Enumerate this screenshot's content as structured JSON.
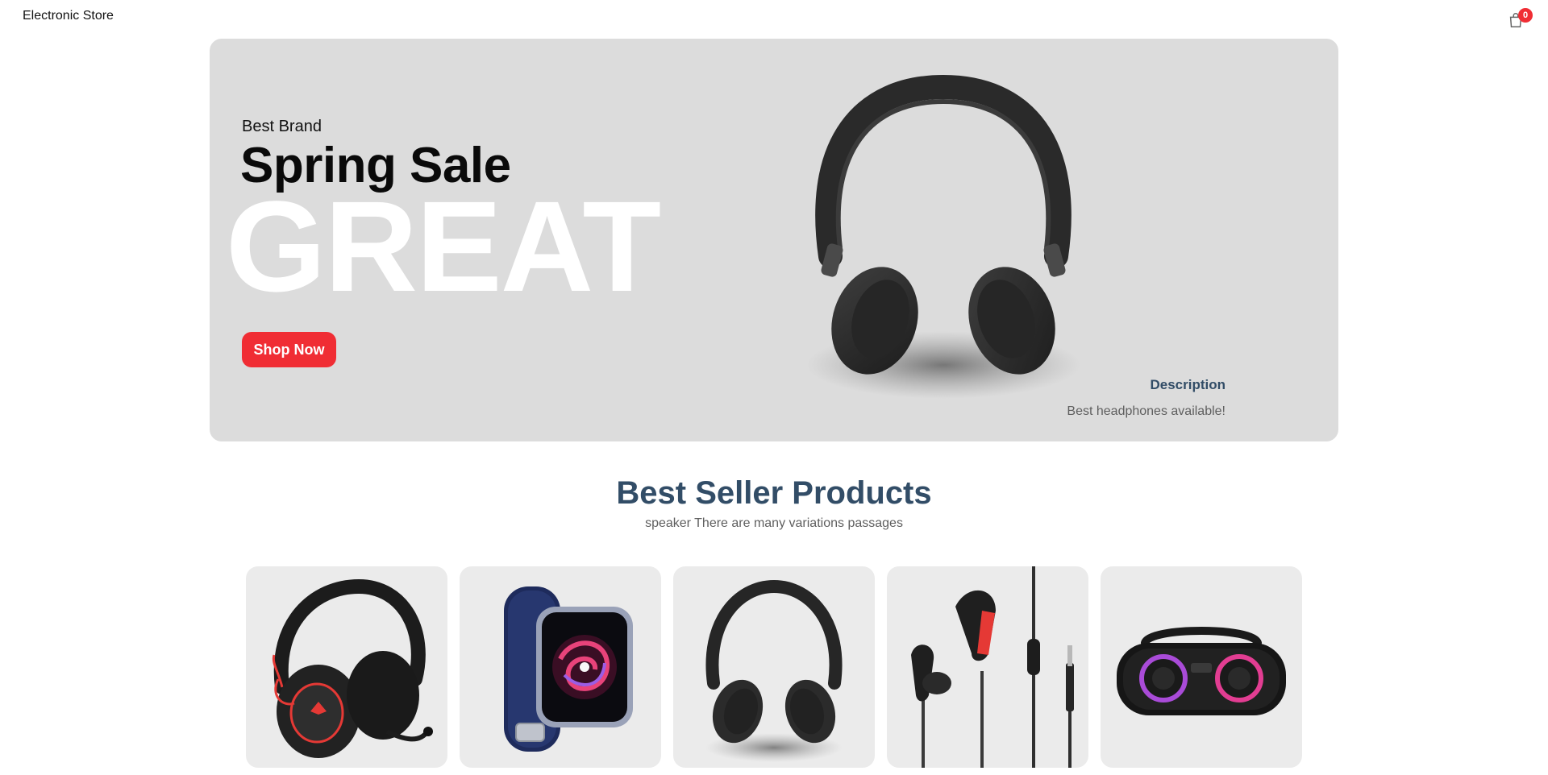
{
  "navbar": {
    "logo": "Electronic Store",
    "cart_icon": "shopping-bag-icon",
    "cart_count": "0"
  },
  "hero": {
    "small_text": "Best Brand",
    "mid_text": "Spring Sale",
    "large_text": "GREAT",
    "button_label": "Shop Now",
    "image": "headphones-image",
    "desc_title": "Description",
    "desc_text": "Best headphones available!"
  },
  "products_section": {
    "title": "Best Seller Products",
    "subtitle": "speaker There are many variations passages",
    "items": [
      {
        "image": "gaming-headset-image"
      },
      {
        "image": "smartwatch-image"
      },
      {
        "image": "headphones-image"
      },
      {
        "image": "earphones-image"
      },
      {
        "image": "speaker-image"
      }
    ]
  },
  "colors": {
    "accent": "#f02d34",
    "heading": "#324d67",
    "hero_bg": "#dcdcdc",
    "card_bg": "#ebebeb"
  }
}
